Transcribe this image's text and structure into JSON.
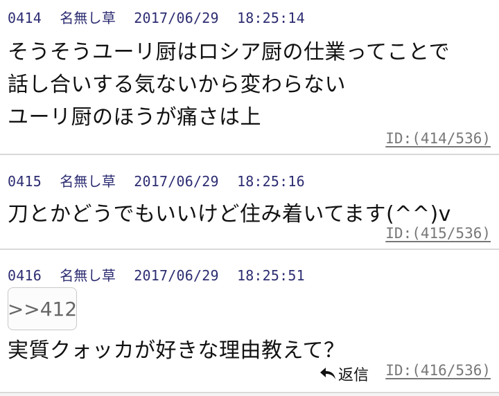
{
  "posts": [
    {
      "number": "0414",
      "name": "名無し草",
      "date": "2017/06/29",
      "time": "18:25:14",
      "lines": [
        "そうそうユーリ厨はロシア厨の仕業ってことで",
        "話し合いする気ないから変わらない",
        "ユーリ厨のほうが痛さは上"
      ],
      "id": "ID:(414/536)"
    },
    {
      "number": "0415",
      "name": "名無し草",
      "date": "2017/06/29",
      "time": "18:25:16",
      "lines": [
        "刀とかどうでもいいけど住み着いてます(^^)v"
      ],
      "id": "ID:(415/536)"
    },
    {
      "number": "0416",
      "name": "名無し草",
      "date": "2017/06/29",
      "time": "18:25:51",
      "anchor": ">>412",
      "lines": [
        "実質クォッカが好きな理由教えて？"
      ],
      "reply_label": "返信",
      "id": "ID:(416/536)"
    }
  ],
  "colors": {
    "meta_text": "#2c2c72",
    "id_text": "#777777",
    "divider": "#d9d9d9",
    "background": "#ffffff"
  },
  "icons": {
    "reply": "reply-arrow-icon"
  }
}
